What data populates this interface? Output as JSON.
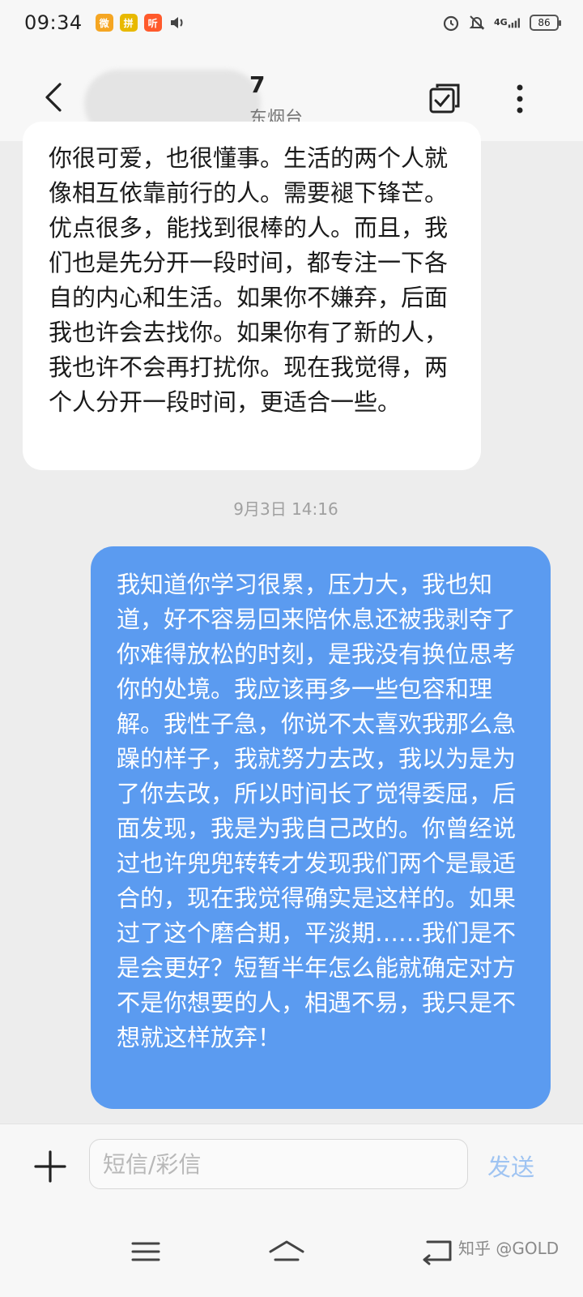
{
  "status_bar": {
    "time": "09:34",
    "app_icons": [
      {
        "name": "weibo-icon",
        "glyph": "微",
        "color": "#f5a623"
      },
      {
        "name": "pinduoduo-icon",
        "glyph": "拼",
        "color": "#e8b900"
      },
      {
        "name": "ting-icon",
        "glyph": "听",
        "color": "#ff5a2c"
      }
    ],
    "network": "4G",
    "battery": "86"
  },
  "header": {
    "contact_name_tail": "7",
    "contact_location": "东烟台"
  },
  "conversation": {
    "incoming_message": "你很可爱，也很懂事。生活的两个人就像相互依靠前行的人。需要褪下锋芒。优点很多，能找到很棒的人。而且，我们也是先分开一段时间，都专注一下各自的内心和生活。如果你不嫌弃，后面我也许会去找你。如果你有了新的人，我也许不会再打扰你。现在我觉得，两个人分开一段时间，更适合一些。",
    "timestamp": "9月3日 14:16",
    "outgoing_message": "我知道你学习很累，压力大，我也知道，好不容易回来陪休息还被我剥夺了你难得放松的时刻，是我没有换位思考你的处境。我应该再多一些包容和理解。我性子急，你说不太喜欢我那么急躁的样子，我就努力去改，我以为是为了你去改，所以时间长了觉得委屈，后面发现，我是为我自己改的。你曾经说过也许兜兜转转才发现我们两个是最适合的，现在我觉得确实是这样的。如果过了这个磨合期，平淡期……我们是不是会更好？短暂半年怎么能就确定对方不是你想要的人，相遇不易，我只是不想就这样放弃！"
  },
  "composer": {
    "placeholder": "短信/彩信",
    "send_label": "发送"
  },
  "watermark": "知乎 @GOLD",
  "colors": {
    "outgoing_bubble": "#5b9bf0",
    "incoming_bubble": "#ffffff",
    "send_disabled": "#9fc4f2"
  }
}
